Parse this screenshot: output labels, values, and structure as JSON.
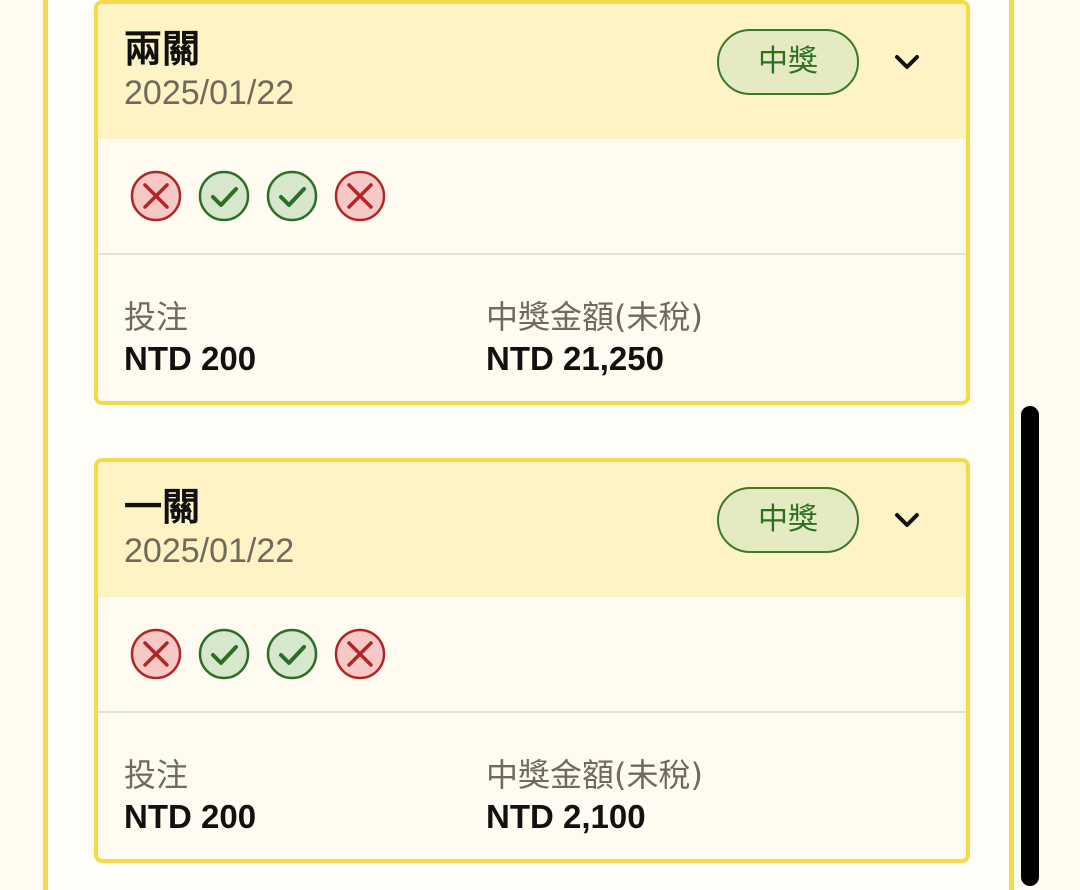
{
  "cards": [
    {
      "title": "兩關",
      "date": "2025/01/22",
      "badge": "中獎",
      "results": [
        "wrong",
        "correct",
        "correct",
        "wrong"
      ],
      "stake_label": "投注",
      "stake_value": "NTD 200",
      "prize_label": "中獎金額(未稅)",
      "prize_value": "NTD 21,250"
    },
    {
      "title": "一關",
      "date": "2025/01/22",
      "badge": "中獎",
      "results": [
        "wrong",
        "correct",
        "correct",
        "wrong"
      ],
      "stake_label": "投注",
      "stake_value": "NTD 200",
      "prize_label": "中獎金額(未稅)",
      "prize_value": "NTD 2,100"
    }
  ],
  "icons": {
    "correct": "check-circle-icon",
    "wrong": "x-circle-icon",
    "expand": "chevron-down-icon"
  },
  "colors": {
    "accent_border": "#f4d94a",
    "header_bg": "#fef3c4",
    "badge_green": "#2f6f1e",
    "wrong_red": "#c0262a"
  }
}
